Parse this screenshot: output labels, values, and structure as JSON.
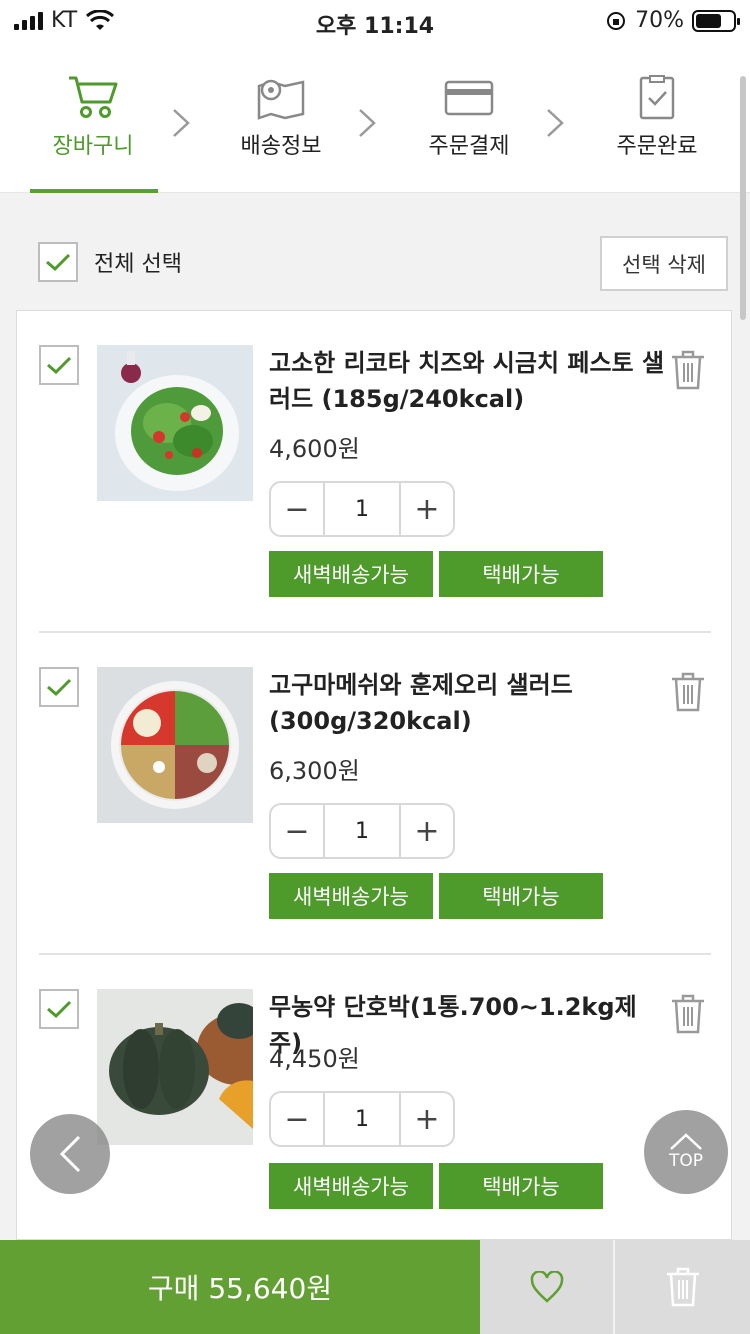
{
  "status": {
    "carrier": "KT",
    "time": "오후 11:14",
    "battery": "70%",
    "battery_level": 0.7
  },
  "steps": [
    {
      "label": "장바구니",
      "icon": "cart-icon",
      "active": true
    },
    {
      "label": "배송정보",
      "icon": "map-pin-icon",
      "active": false
    },
    {
      "label": "주문결제",
      "icon": "credit-card-icon",
      "active": false
    },
    {
      "label": "주문완료",
      "icon": "clipboard-check-icon",
      "active": false
    }
  ],
  "select_all": {
    "label": "전체 선택",
    "checked": true
  },
  "delete_selected_label": "선택 삭제",
  "items": [
    {
      "title": "고소한 리코타 치즈와 시금치 페스토 샐러드 (185g/240kcal)",
      "price": "4,600원",
      "quantity": "1",
      "tags": [
        "새벽배송가능",
        "택배가능"
      ],
      "checked": true
    },
    {
      "title": "고구마메쉬와 훈제오리 샐러드 (300g/320kcal)",
      "price": "6,300원",
      "quantity": "1",
      "tags": [
        "새벽배송가능",
        "택배가능"
      ],
      "checked": true
    },
    {
      "title": "무농약 단호박(1통.700~1.2kg제주)",
      "price": "4,450원",
      "quantity": "1",
      "tags": [
        "새벽배송가능",
        "택배가능"
      ],
      "checked": true
    }
  ],
  "top_label": "TOP",
  "buy_label": "구매 55,640원",
  "colors": {
    "accent": "#4e9a2b",
    "buy_bar": "#63a033",
    "gray_button": "#dcdcdc"
  }
}
